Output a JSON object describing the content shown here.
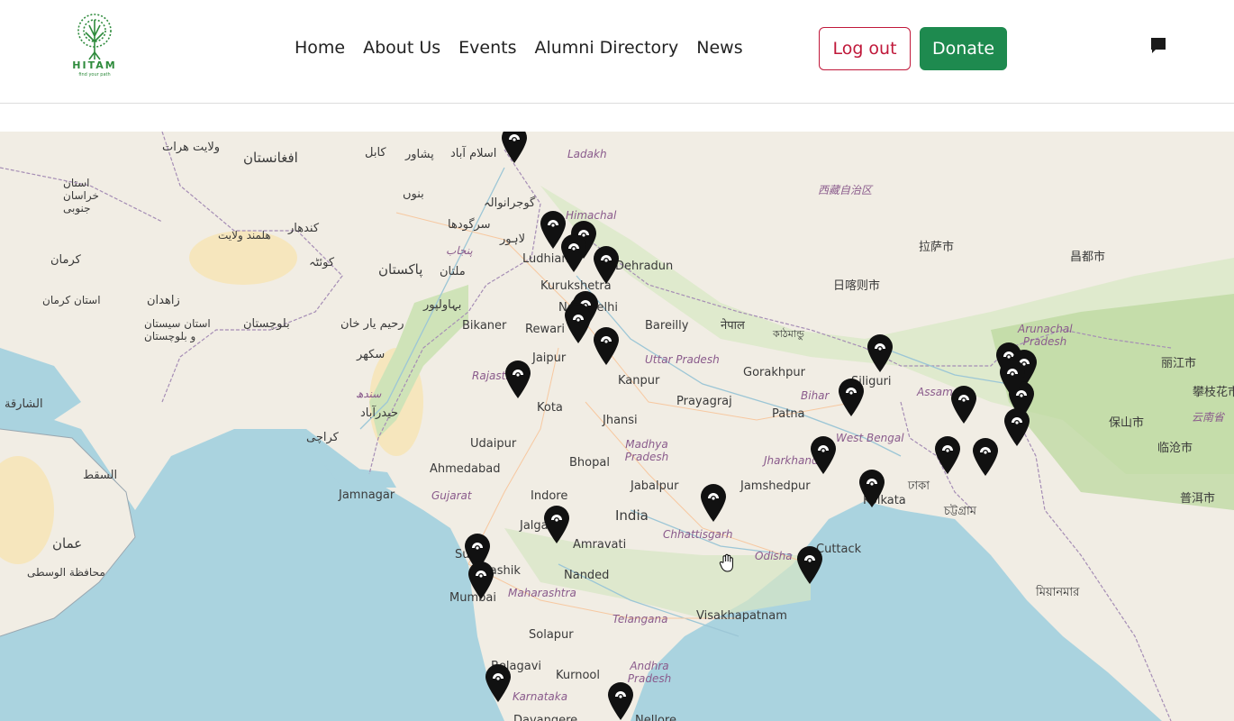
{
  "brand": {
    "name": "HITAM",
    "tagline": "find your path"
  },
  "nav": {
    "items": [
      "Home",
      "About Us",
      "Events",
      "Alumni Directory",
      "News"
    ]
  },
  "actions": {
    "logout_label": "Log out",
    "donate_label": "Donate"
  },
  "colors": {
    "logout": "#c0183a",
    "donate": "#1e8a4f",
    "brand": "#2e8b3c",
    "land": "#f1ede4",
    "sea": "#aad3df"
  },
  "map": {
    "labels": [
      "ولايت هرات",
      "افغانستان",
      "استان خراسان جنوبی",
      "کابل",
      "پشاور",
      "اسلام آباد",
      "Ladakh",
      "بنوں",
      "گوجرانوالہ",
      "سرگودھا",
      "کندهار",
      "هلمند ولايت",
      "Himachal",
      "کرمان",
      "کوئٹہ",
      "لاہور",
      "Ludhiana",
      "پنجاب",
      "زاهدان",
      "ملتان",
      "پاکستان",
      "Dehradun",
      "Kurukshetra",
      "استان کرمان",
      "استان سیستان و بلوچستان",
      "بلوچستان",
      "بہاولپور",
      "رحیم یار خان",
      "New Delhi",
      "Bikaner",
      "Rewari",
      "Bareilly",
      "नेपाल",
      "Jaipur",
      "Rajasthan",
      "سکھر",
      "Uttar Pradesh",
      "Gorakhpur",
      "Kanpur",
      "Kota",
      "Prayagraj",
      "Bihar",
      "Patna",
      "Jhansi",
      "سندھ",
      "حیدرآباد",
      "کراچی",
      "Udaipur",
      "Madhya Pradesh",
      "Jharkhand",
      "West Bengal",
      "Bhopal",
      "Ahmedabad",
      "Jamshedpur",
      "Jabalpur",
      "Indore",
      "Jamnagar",
      "Gujarat",
      "India",
      "Kolkata",
      "Jalgaon",
      "Chhattisgarh",
      "Amravati",
      "Surat",
      "Nashik",
      "Mumbai",
      "Nanded",
      "Maharashtra",
      "Odisha",
      "Cuttack",
      "Telangana",
      "Visakhapatnam",
      "Solapur",
      "Belagavi",
      "Kurnool",
      "Andhra Pradesh",
      "Karnataka",
      "Nellore",
      "Davangere",
      "西藏自治区",
      "拉萨市",
      "日喀则市",
      "昌都市",
      "Arunachal Pradesh",
      "丽江市",
      "攀枝花市",
      "保山市",
      "云南省",
      "临沧市",
      "普洱市",
      "Siliguri",
      "Assam",
      "ঢাকা",
      "চট্টগ্রাম",
      "মিয়ানমার",
      "السقط",
      "عمان",
      "الشارقة",
      "محافظة الوسطى",
      "কাঠমান্ডু"
    ],
    "pin_count": 30
  }
}
